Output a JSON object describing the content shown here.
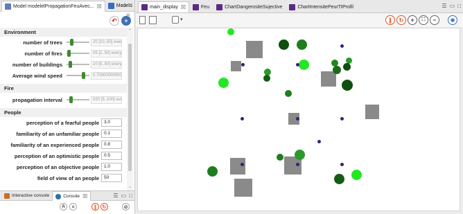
{
  "left_tabs": {
    "params_tab": "Model modelelPropagationFeuAvec...",
    "models_tab": "Models"
  },
  "sections": {
    "environment": "Environment",
    "fire": "Fire",
    "people": "People"
  },
  "environment_params": [
    {
      "label": "number of trees",
      "value": "20 [10..50] every",
      "level": 0.2
    },
    {
      "label": "number of fires",
      "value": "05 [2..50] every",
      "level": 0.05
    },
    {
      "label": "number of buildings",
      "value": "10 [5..50] every",
      "level": 0.12
    },
    {
      "label": "Average wind speed",
      "value": "0.700000000000",
      "level": 0.72
    }
  ],
  "fire_params": [
    {
      "label": "propagation interval",
      "value": "020 [5..100] eve",
      "level": 0.15
    }
  ],
  "people_params": [
    {
      "label": "perception of a fearful people",
      "value": "3.0"
    },
    {
      "label": "familiarity of an unfamiliar people",
      "value": "0.1"
    },
    {
      "label": "familiarity of an experienced people",
      "value": "0.8"
    },
    {
      "label": "perception of an optimistic people",
      "value": "0.5"
    },
    {
      "label": "perception of an objective people",
      "value": "1.0"
    },
    {
      "label": "field of view of an people",
      "value": "50"
    }
  ],
  "console_tabs": {
    "interactive": "Interactive console",
    "console": "Console"
  },
  "display_tabs": [
    {
      "label": "main_display",
      "active": true
    },
    {
      "label": "Feu",
      "active": false
    },
    {
      "label": "ChartDangerositeSujective",
      "active": false
    },
    {
      "label": "ChartIntensitePeurTtProfil",
      "active": false
    }
  ],
  "colors": {
    "accent_red": "#e0552b",
    "accent_orange": "#f08a2a",
    "tab_purple": "#5b2a86",
    "bright_green": "#33ee33",
    "dark_green": "#125c12",
    "mid_green": "#2a8a2a",
    "people_purple": "#3c1f7a",
    "building_gray": "#8a8a8a"
  },
  "icons": [
    "back-icon",
    "add-icon",
    "pause-icon",
    "reload-icon",
    "zoom-in-icon",
    "zoom-fit-icon",
    "zoom-out-icon",
    "camera-icon",
    "snapshot-icon",
    "layers-icon"
  ]
}
